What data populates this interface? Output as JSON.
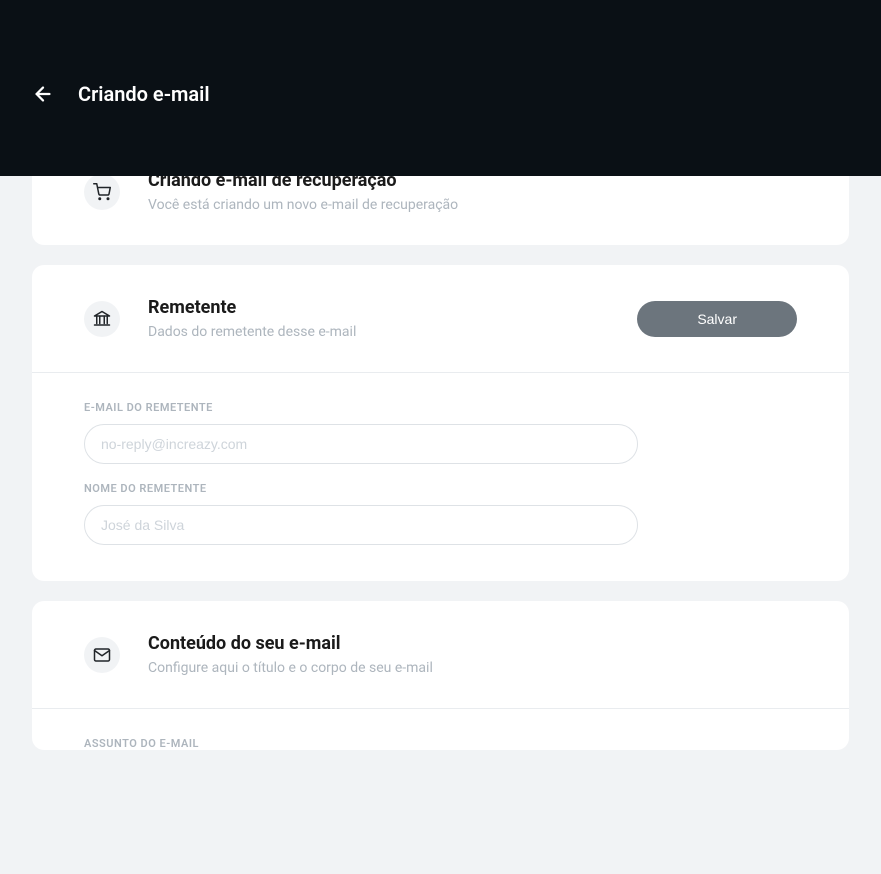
{
  "header": {
    "title": "Criando e-mail"
  },
  "intro_card": {
    "title": "Criando e-mail de recuperação",
    "subtitle": "Você está criando um novo e-mail de recuperação"
  },
  "sender_card": {
    "title": "Remetente",
    "subtitle": "Dados do remetente desse e-mail",
    "save_label": "Salvar",
    "fields": {
      "email": {
        "label": "E-MAIL DO REMETENTE",
        "placeholder": "no-reply@increazy.com",
        "value": ""
      },
      "name": {
        "label": "NOME DO REMETENTE",
        "placeholder": "José da Silva",
        "value": ""
      }
    }
  },
  "content_card": {
    "title": "Conteúdo do seu e-mail",
    "subtitle": "Configure aqui o título e o corpo de seu e-mail",
    "fields": {
      "subject": {
        "label": "ASSUNTO DO E-MAIL"
      }
    }
  }
}
